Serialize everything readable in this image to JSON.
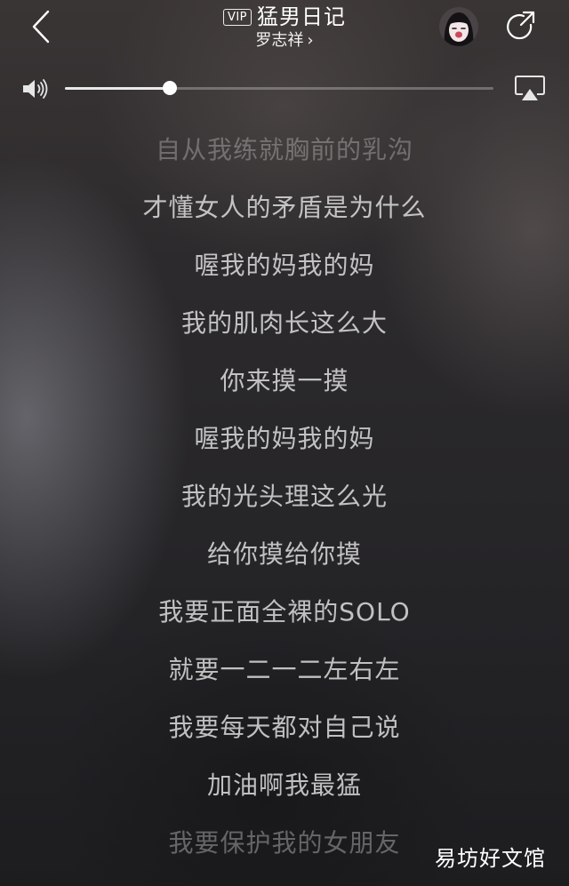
{
  "header": {
    "vip_badge": "VIP",
    "song_title": "猛男日记",
    "artist": "罗志祥",
    "artist_chevron": "›",
    "icons": {
      "back": "chevron-left-icon",
      "share": "share-icon",
      "avatar": "avatar"
    }
  },
  "volume": {
    "level": 0.245,
    "icons": {
      "speaker": "speaker-icon",
      "airplay": "airplay-icon"
    }
  },
  "lyrics": [
    "自从我练就胸前的乳沟",
    "才懂女人的矛盾是为什么",
    "喔我的妈我的妈",
    "我的肌肉长这么大",
    "你来摸一摸",
    "喔我的妈我的妈",
    "我的光头理这么光",
    "给你摸给你摸",
    "我要正面全裸的SOLO",
    "就要一二一二左右左",
    "我要每天都对自己说",
    "加油啊我最猛",
    "我要保护我的女朋友"
  ],
  "watermark": "易坊好文馆",
  "colors": {
    "text": "#ffffff",
    "lyric": "#d7d7d7"
  }
}
